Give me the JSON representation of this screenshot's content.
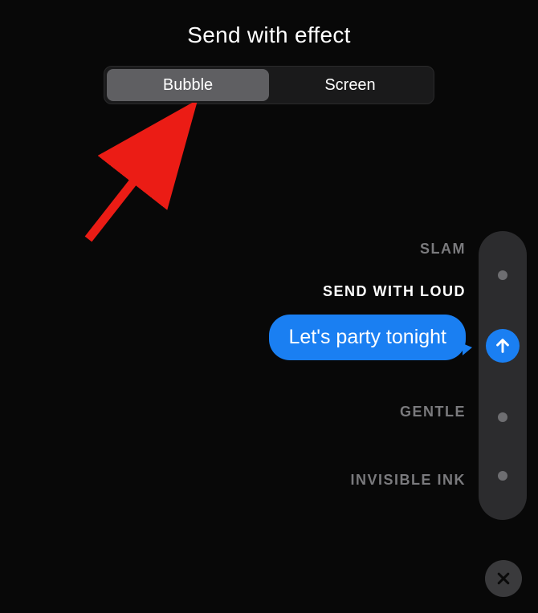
{
  "header": {
    "title": "Send with effect"
  },
  "segmented": {
    "items": [
      {
        "label": "Bubble",
        "active": true
      },
      {
        "label": "Screen",
        "active": false
      }
    ]
  },
  "effects": {
    "slam": "SLAM",
    "loud": "SEND WITH LOUD",
    "gentle": "GENTLE",
    "invisible": "INVISIBLE INK"
  },
  "message": {
    "text": "Let's party tonight"
  },
  "colors": {
    "accent": "#1a7ff2",
    "annotation": "#eb1c15"
  }
}
